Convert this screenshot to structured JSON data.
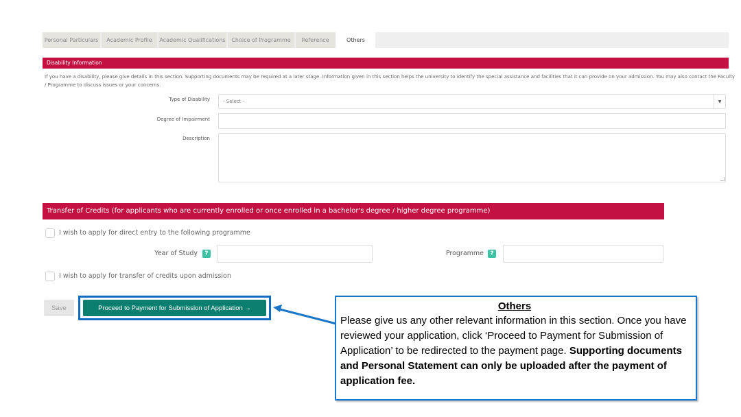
{
  "tabs": [
    {
      "label": "Personal Particulars",
      "active": false
    },
    {
      "label": "Academic Profile",
      "active": false
    },
    {
      "label": "Academic Qualifications",
      "active": false
    },
    {
      "label": "Choice of Programme",
      "active": false
    },
    {
      "label": "Reference",
      "active": false
    },
    {
      "label": "Others",
      "active": true
    }
  ],
  "disability": {
    "header": "Disability Information",
    "description": "If you have a disability, please give details in this section. Supporting documents may be required at a later stage. Information given in this section helps the university to identify the special assistance and facilities that it can provide on your admission. You may also contact the Faculty / Programme to discuss issues or your concerns.",
    "type_label": "Type of Disability",
    "type_value": "- Select -",
    "degree_label": "Degree of Impairment",
    "degree_value": "",
    "description_label": "Description",
    "description_value": ""
  },
  "transfer": {
    "header": "Transfer of Credits (for applicants who are currently enrolled or once enrolled in a bachelor's degree / higher degree programme)",
    "direct_entry_label": "I wish to apply for direct entry to the following programme",
    "direct_entry_checked": false,
    "year_label": "Year of Study",
    "year_value": "",
    "programme_label": "Programme",
    "programme_value": "",
    "help_glyph": "?",
    "transfer_label": "I wish to apply for transfer of credits upon admission",
    "transfer_checked": false
  },
  "actions": {
    "save_label": "Save",
    "proceed_label": "Proceed to Payment for Submission of Application →"
  },
  "callout": {
    "title": "Others",
    "body": "Please give us any other relevant information in this section. Once you have reviewed your application, click ‘Proceed to Payment for Submission of Application’ to be redirected to the payment page.",
    "bold": "Supporting documents and Personal Statement can only be uploaded after the payment of application fee."
  },
  "colors": {
    "section_header": "#c41141",
    "primary_button": "#0a7f6f",
    "annotation_blue": "#1b76c8",
    "help_icon": "#3cc3a6"
  }
}
